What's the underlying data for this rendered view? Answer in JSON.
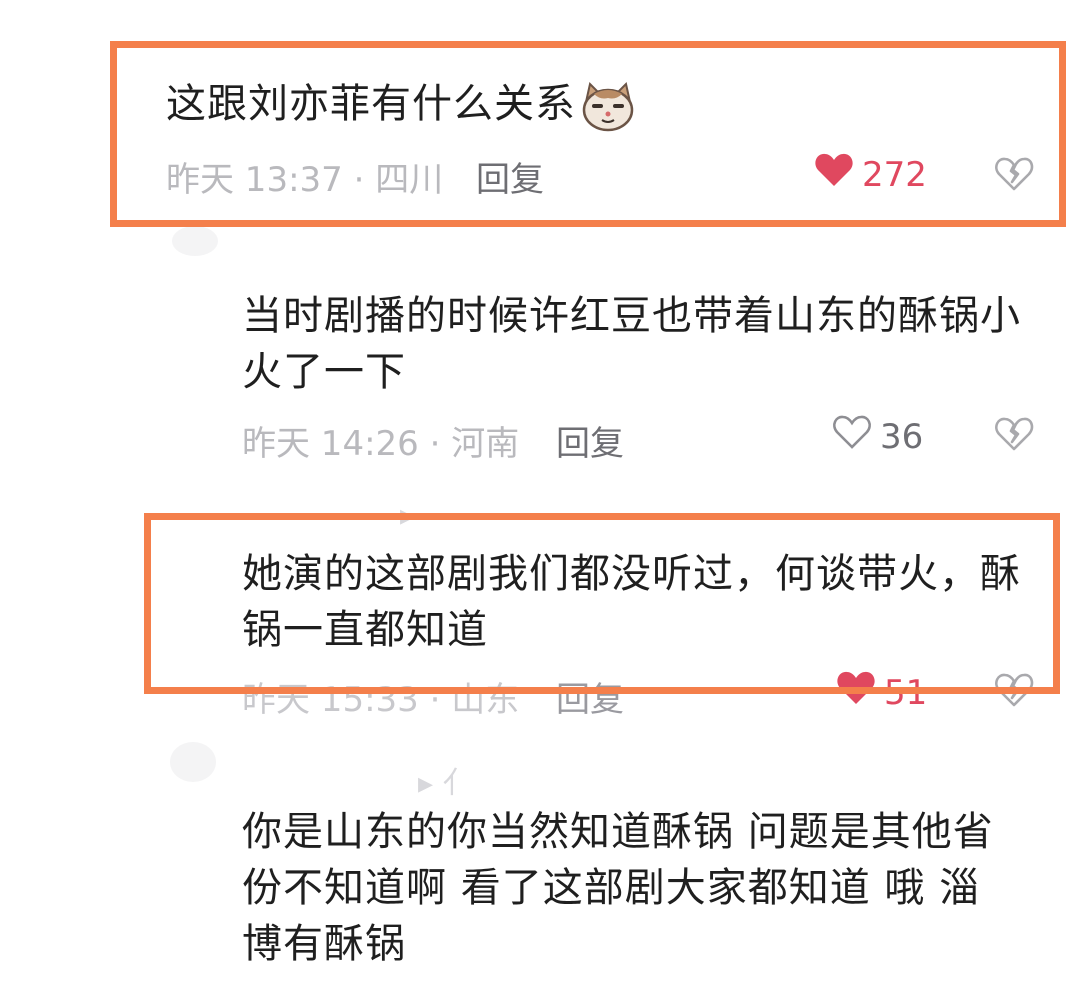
{
  "comments": [
    {
      "text": "这跟刘亦菲有什么关系",
      "emoji": "cat-emoji",
      "meta": "昨天 13:37 · 四川",
      "reply": "回复",
      "likes": "272",
      "liked": true,
      "highlighted": true
    },
    {
      "text": "当时剧播的时候许红豆也带着山东的酥锅小\n火了一下",
      "meta": "昨天 14:26 · 河南",
      "reply": "回复",
      "likes": "36",
      "liked": false,
      "highlighted": false
    },
    {
      "text": "她演的这部剧我们都没听过，何谈带火，酥\n锅一直都知道",
      "meta": "昨天 15:33 · 山东",
      "reply": "回复",
      "likes": "51",
      "liked": true,
      "highlighted": true
    },
    {
      "text": "你是山东的你当然知道酥锅  问题是其他省\n份不知道啊  看了这部剧大家都知道 哦  淄\n博有酥锅",
      "highlighted": false
    }
  ],
  "colors": {
    "highlight": "#f47f4b",
    "like_red": "#e0485f",
    "meta_gray": "#b9b9bd"
  }
}
